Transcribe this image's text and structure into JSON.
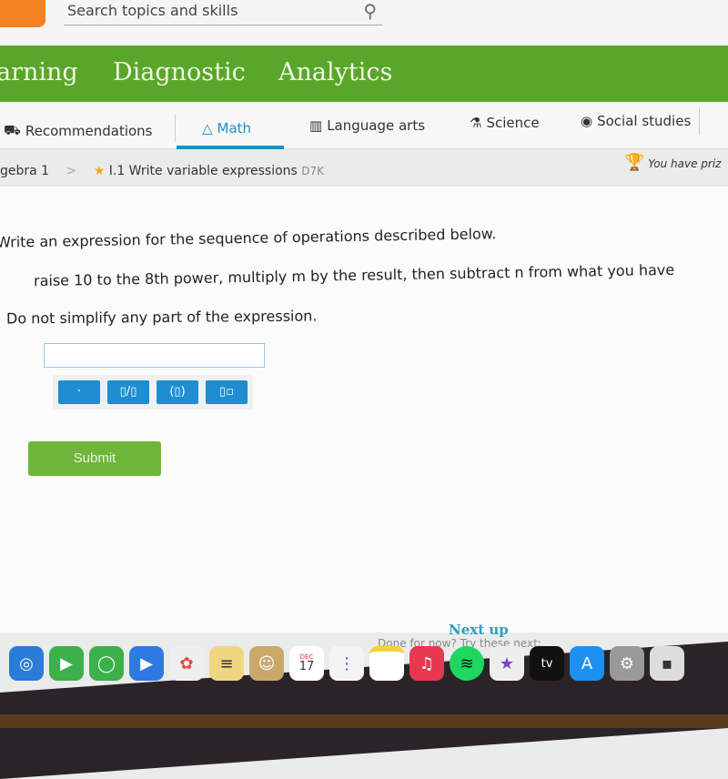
{
  "header": {
    "search_placeholder": "Search topics and skills"
  },
  "nav": {
    "items": [
      "arning",
      "Diagnostic",
      "Analytics"
    ]
  },
  "subjects": [
    {
      "label": "Recommendations",
      "icon": "recommendations-icon"
    },
    {
      "label": "Math",
      "icon": "pyramid-icon",
      "active": true
    },
    {
      "label": "Language arts",
      "icon": "book-icon"
    },
    {
      "label": "Science",
      "icon": "flask-icon"
    },
    {
      "label": "Social studies",
      "icon": "globe-icon"
    }
  ],
  "accent": "#1e8fc8",
  "breadcrumb": {
    "course": "gebra 1",
    "separator": ">",
    "skill": "I.1 Write variable expressions",
    "code": "D7K"
  },
  "prize": "You have priz",
  "question": {
    "prompt": "Write an expression for the sequence of operations described below.",
    "ops": "raise 10 to the 8th power, multiply m by the result, then subtract n from what you have",
    "note": "Do not simplify any part of the expression."
  },
  "answer": {
    "value": ""
  },
  "keypad": [
    "·",
    "▯/▯",
    "(▯)",
    "▯▫"
  ],
  "submit": "Submit",
  "next_up": "Next up",
  "done": "Done for now? Try these next:",
  "dock": {
    "calendar_month": "DEC",
    "calendar_day": "17",
    "tv": "tv"
  }
}
